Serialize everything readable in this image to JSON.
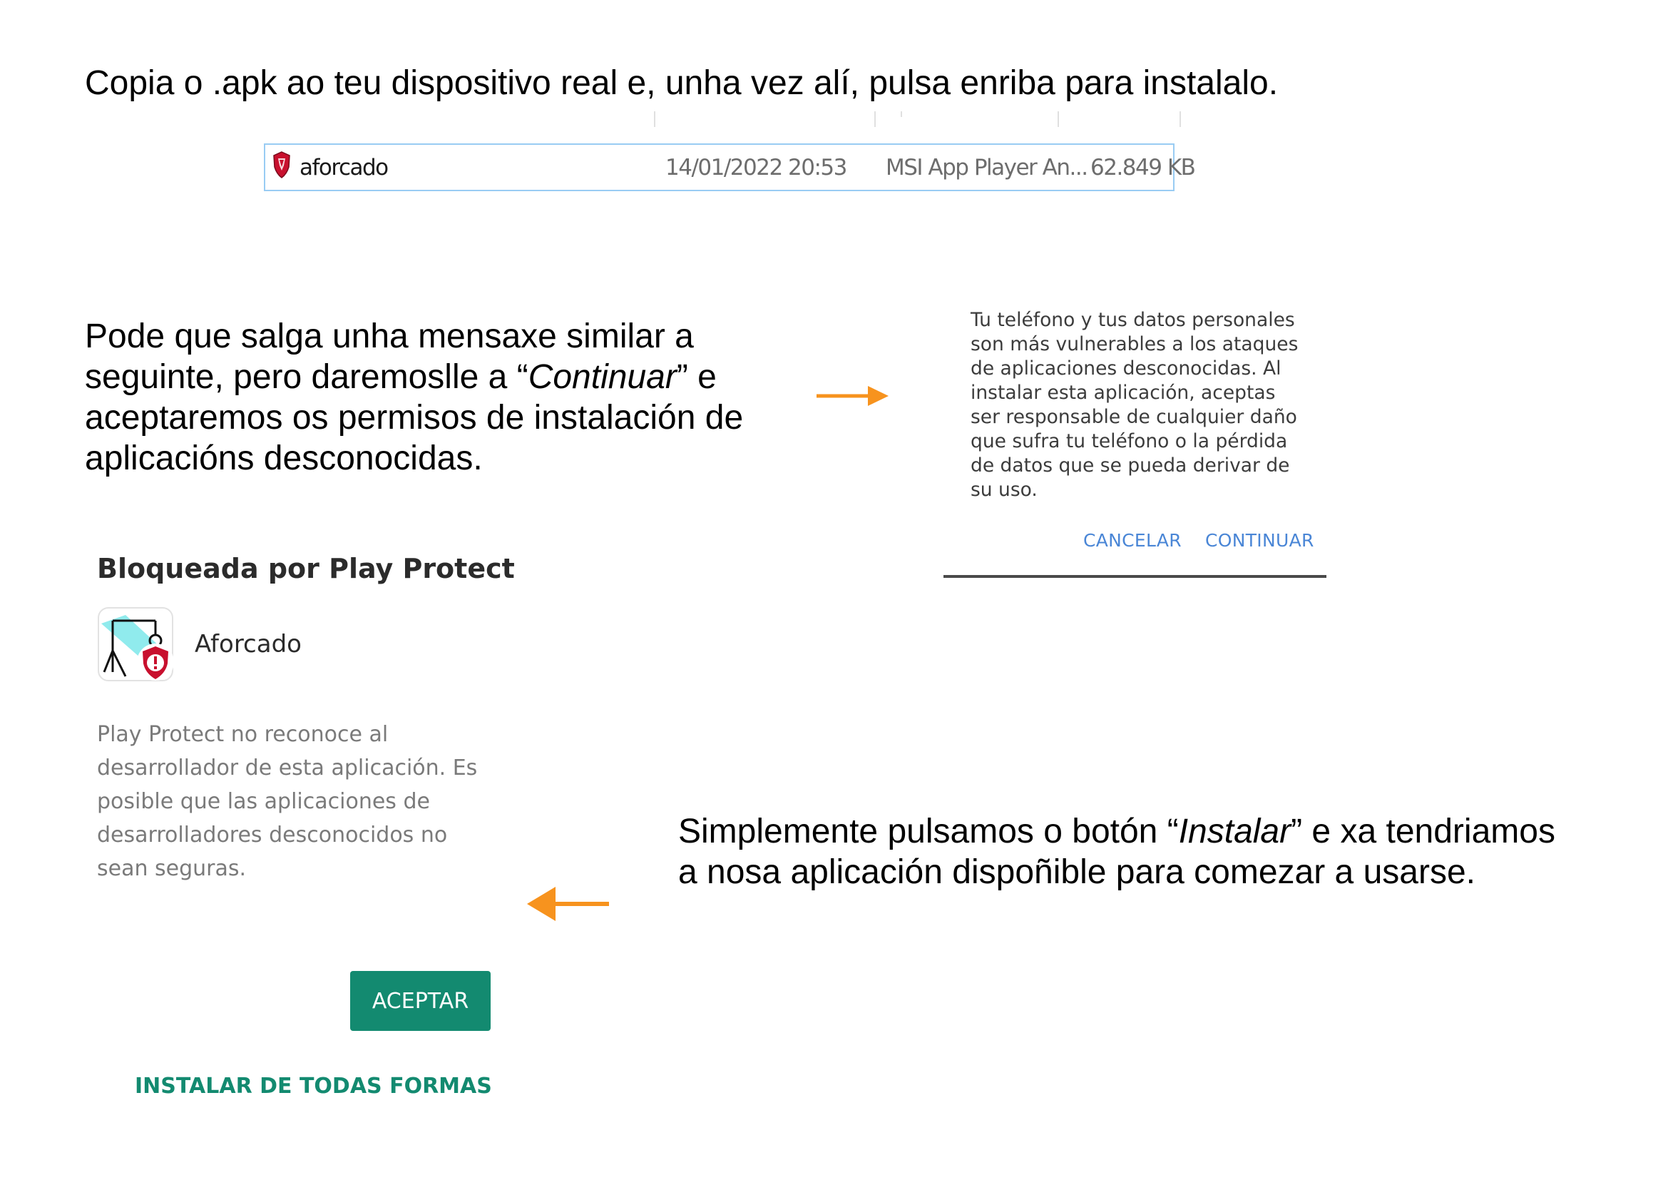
{
  "step1": {
    "text": "Copia o .apk ao teu dispositivo real e, unha vez alí, pulsa enriba para instalalo."
  },
  "file_row": {
    "icon": "msi-app-icon",
    "name": "aforcado",
    "date": "14/01/2022 20:53",
    "type": "MSI App Player An...",
    "size": "62.849 KB"
  },
  "step2": {
    "before": "Pode que salga unha mensaxe similar a seguinte, pero daremoslle a “",
    "emphasis": "Continuar",
    "after": "” e aceptaremos os permisos de instalación de aplicacións desconocidas."
  },
  "unknown_apps_dialog": {
    "message": "Tu teléfono y tus datos personales son más vulnerables a los ataques de aplicaciones desconocidas. Al instalar esta aplicación, aceptas ser responsable de cualquier daño que sufra tu teléfono o la pérdida de datos que se pueda derivar de su uso.",
    "cancel_label": "CANCELAR",
    "continue_label": "CONTINUAR"
  },
  "play_protect_dialog": {
    "title": "Bloqueada por Play Protect",
    "app_name": "Aforcado",
    "body": "Play Protect no reconoce al desarrollador de esta aplicación. Es posible que las aplicaciones de desarrolladores desconocidos no sean seguras.",
    "accept_label": "ACEPTAR",
    "install_anyway_label": "INSTALAR DE TODAS FORMAS"
  },
  "step3": {
    "before": "Simplemente pulsamos o botón “",
    "emphasis": "Instalar",
    "after": "” e xa tendriamos a nosa aplicación dispoñible para comezar a usarse."
  },
  "colors": {
    "arrow": "#f7931e",
    "dialog_link": "#4a86d6",
    "play_protect_green": "#138a70",
    "file_row_border": "#99ccf3"
  }
}
